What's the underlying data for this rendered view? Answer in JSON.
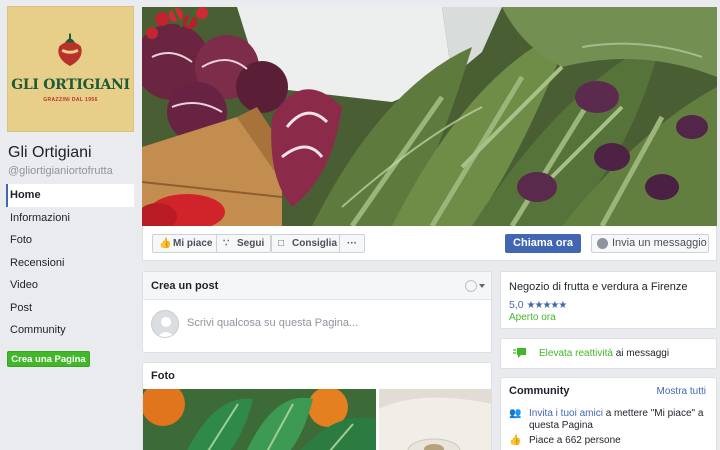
{
  "page": {
    "name": "Gli Ortigiani",
    "handle": "@gliortigianiortofrutta",
    "logo": {
      "brand": "GLI ORTIGIANI",
      "tagline": "GRAZZINI DAL 1956",
      "brand_color": "#1e5a35",
      "accent_color": "#b8322b",
      "bg_color": "#e7cf8a"
    }
  },
  "sidebar": {
    "items": [
      {
        "label": "Home",
        "active": true
      },
      {
        "label": "Informazioni"
      },
      {
        "label": "Foto"
      },
      {
        "label": "Recensioni"
      },
      {
        "label": "Video"
      },
      {
        "label": "Post"
      },
      {
        "label": "Community"
      }
    ],
    "create_page_label": "Crea una Pagina"
  },
  "actions": {
    "like": {
      "label": "Mi piace",
      "icon": "thumbs-up-icon"
    },
    "follow": {
      "label": "Segui",
      "icon": "rss-icon"
    },
    "share": {
      "label": "Consiglia",
      "icon": "share-icon"
    },
    "more": {
      "label": "···",
      "icon": "more-icon"
    },
    "call": {
      "label": "Chiama ora"
    },
    "message": {
      "label": "Invia un messaggio",
      "icon": "messenger-icon"
    }
  },
  "create_post": {
    "title": "Crea un post",
    "placeholder": "Scrivi qualcosa su questa Pagina..."
  },
  "photos": {
    "title": "Foto"
  },
  "info": {
    "category": "Negozio di frutta e verdura a Firenze",
    "rating": "5,0",
    "stars": "★★★★★",
    "status": "Aperto ora"
  },
  "responsiveness": {
    "highlight": "Elevata reattività",
    "text": " ai messaggi"
  },
  "community": {
    "title": "Community",
    "see_all": "Mostra tutti",
    "invite_link": "Invita i tuoi amici",
    "invite_text": " a mettere \"Mi piace\" a questa Pagina",
    "likes": "Piace a 662 persone"
  },
  "colors": {
    "fb_blue": "#4267b2",
    "green": "#42b72a",
    "bg": "#e9ebee"
  }
}
